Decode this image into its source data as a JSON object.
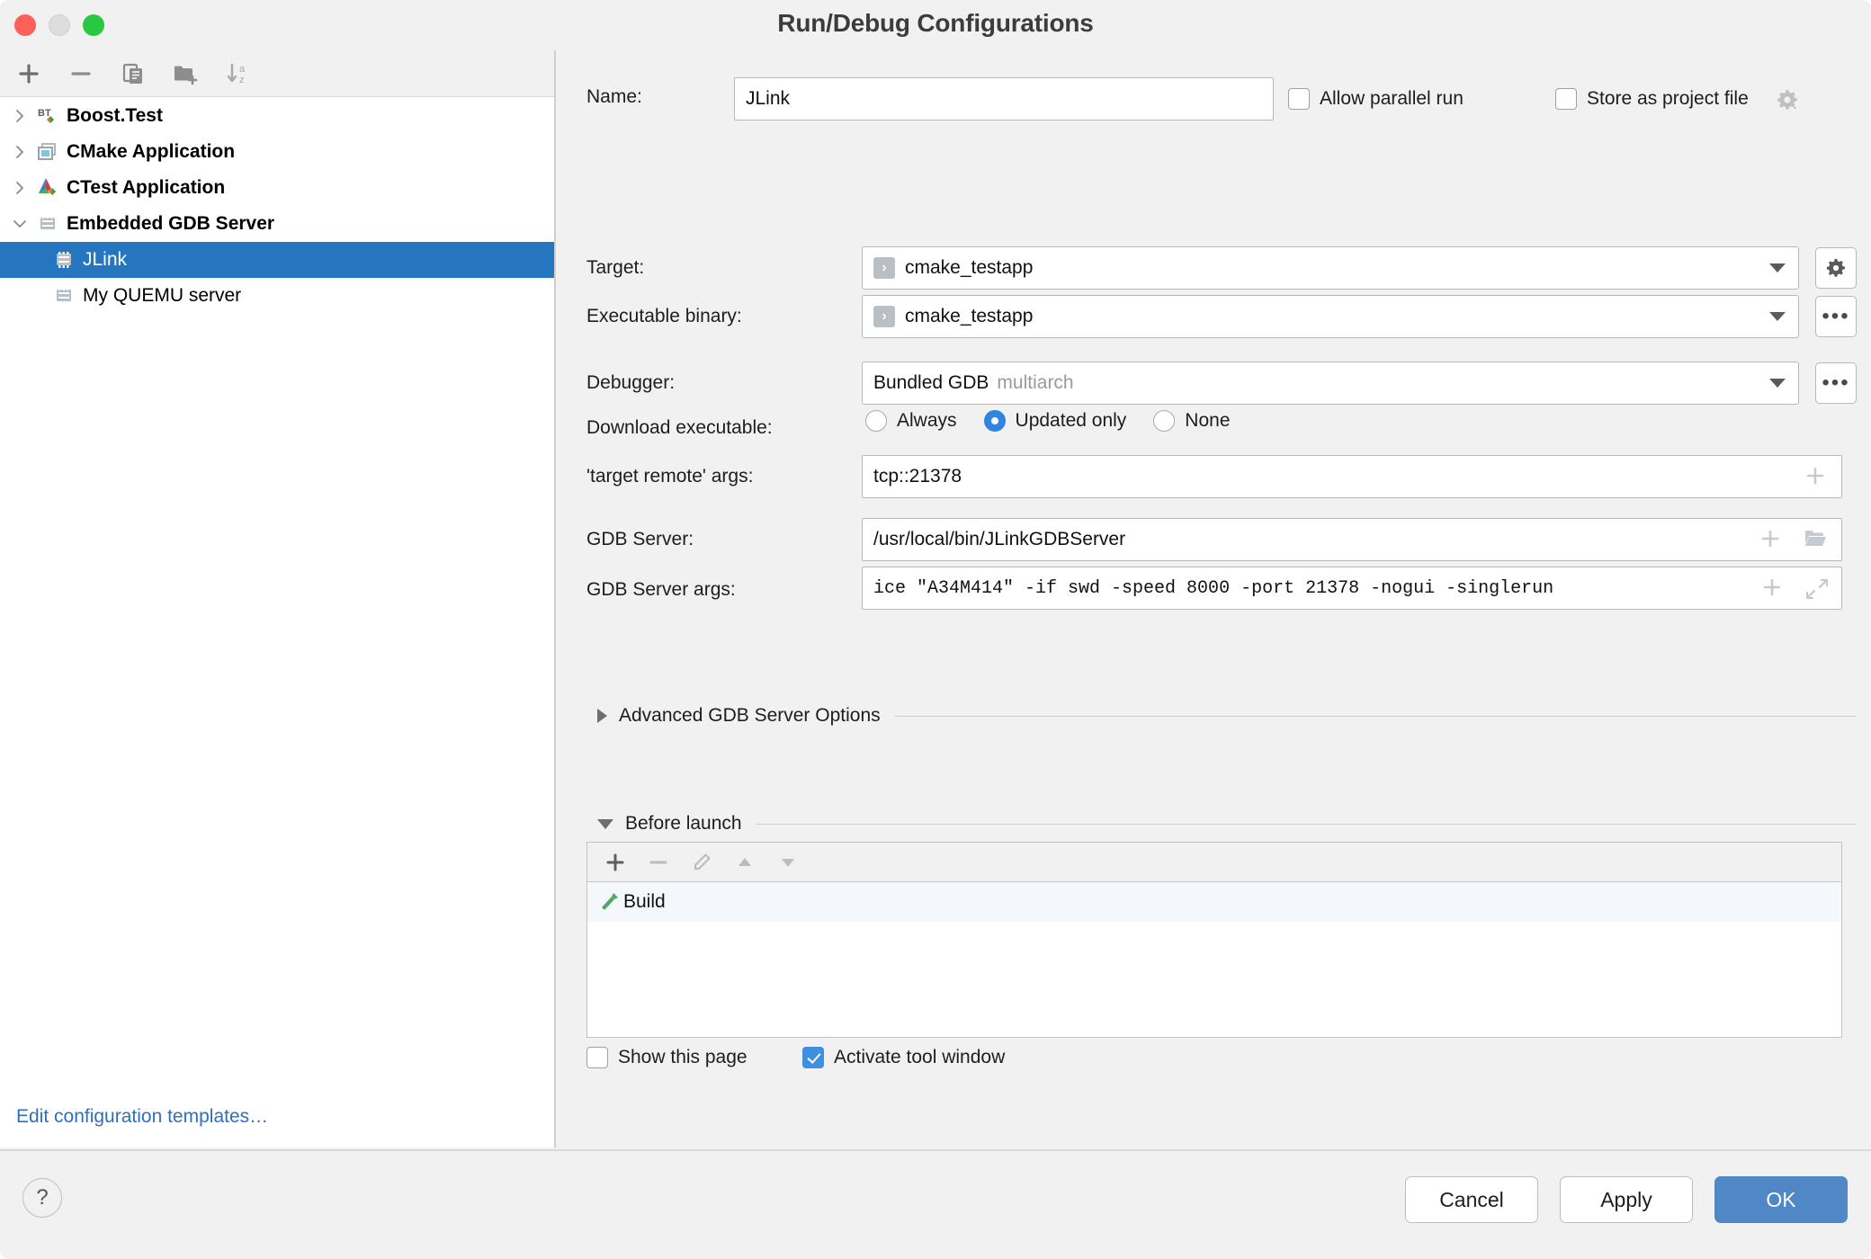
{
  "window": {
    "title": "Run/Debug Configurations",
    "traffic_lights": [
      "close",
      "minimize",
      "zoom"
    ]
  },
  "sidebar": {
    "toolbar": [
      {
        "name": "add",
        "icon": "plus-icon"
      },
      {
        "name": "remove",
        "icon": "minus-icon"
      },
      {
        "name": "copy",
        "icon": "copy-icon"
      },
      {
        "name": "new-folder",
        "icon": "folder-add-icon"
      },
      {
        "name": "sort",
        "icon": "sort-alphabetical-icon"
      }
    ],
    "tree": [
      {
        "label": "Boost.Test",
        "icon": "boost-test-icon",
        "level": 0,
        "expanded": false,
        "bold": true,
        "selected": false
      },
      {
        "label": "CMake Application",
        "icon": "cmake-application-icon",
        "level": 0,
        "expanded": false,
        "bold": true,
        "selected": false
      },
      {
        "label": "CTest Application",
        "icon": "ctest-application-icon",
        "level": 0,
        "expanded": false,
        "bold": true,
        "selected": false
      },
      {
        "label": "Embedded GDB Server",
        "icon": "chip-icon",
        "level": 0,
        "expanded": true,
        "bold": true,
        "selected": false
      },
      {
        "label": "JLink",
        "icon": "chip-icon",
        "level": 1,
        "expanded": null,
        "bold": false,
        "selected": true
      },
      {
        "label": "My QUEMU server",
        "icon": "chip-icon",
        "level": 1,
        "expanded": null,
        "bold": false,
        "selected": false
      }
    ],
    "edit_templates_link": "Edit configuration templates…"
  },
  "form": {
    "name_label": "Name:",
    "name_value": "JLink",
    "allow_parallel_run": {
      "label": "Allow parallel run",
      "checked": false
    },
    "store_as_project_file": {
      "label": "Store as project file",
      "checked": false
    },
    "target_label": "Target:",
    "target_value": "cmake_testapp",
    "executable_label": "Executable binary:",
    "executable_value": "cmake_testapp",
    "debugger_label": "Debugger:",
    "debugger_value": "Bundled GDB",
    "debugger_value_suffix": "multiarch",
    "download_label": "Download executable:",
    "download_options": [
      {
        "label": "Always",
        "selected": false
      },
      {
        "label": "Updated only",
        "selected": true
      },
      {
        "label": "None",
        "selected": false
      }
    ],
    "target_remote_label": "'target remote' args:",
    "target_remote_value": "tcp::21378",
    "gdb_server_label": "GDB Server:",
    "gdb_server_value": "/usr/local/bin/JLinkGDBServer",
    "gdb_server_args_label": "GDB Server args:",
    "gdb_server_args_value": "ice \"A34M414\" -if swd -speed 8000 -port 21378 -nogui -singlerun",
    "advanced_section": "Advanced GDB Server Options",
    "before_launch_section": "Before launch",
    "before_launch_toolbar": [
      {
        "name": "add",
        "icon": "plus-icon",
        "enabled": true
      },
      {
        "name": "remove",
        "icon": "minus-icon",
        "enabled": false
      },
      {
        "name": "edit",
        "icon": "pencil-icon",
        "enabled": false
      },
      {
        "name": "move-up",
        "icon": "triangle-up-icon",
        "enabled": false
      },
      {
        "name": "move-down",
        "icon": "triangle-down-icon",
        "enabled": false
      }
    ],
    "before_launch_items": [
      {
        "label": "Build",
        "icon": "hammer-icon"
      }
    ],
    "show_this_page": {
      "label": "Show this page",
      "checked": false
    },
    "activate_tool_window": {
      "label": "Activate tool window",
      "checked": true
    }
  },
  "footer": {
    "help": "?",
    "cancel": "Cancel",
    "apply": "Apply",
    "ok": "OK"
  },
  "colors": {
    "selection_blue": "#2675bf",
    "accent_blue": "#4f87c7",
    "radio_blue": "#2f84e0",
    "checkbox_blue": "#3f8fe0",
    "link_blue": "#2f6fbf",
    "panel_bg": "#f1f1f1",
    "build_green": "#5aa469"
  }
}
